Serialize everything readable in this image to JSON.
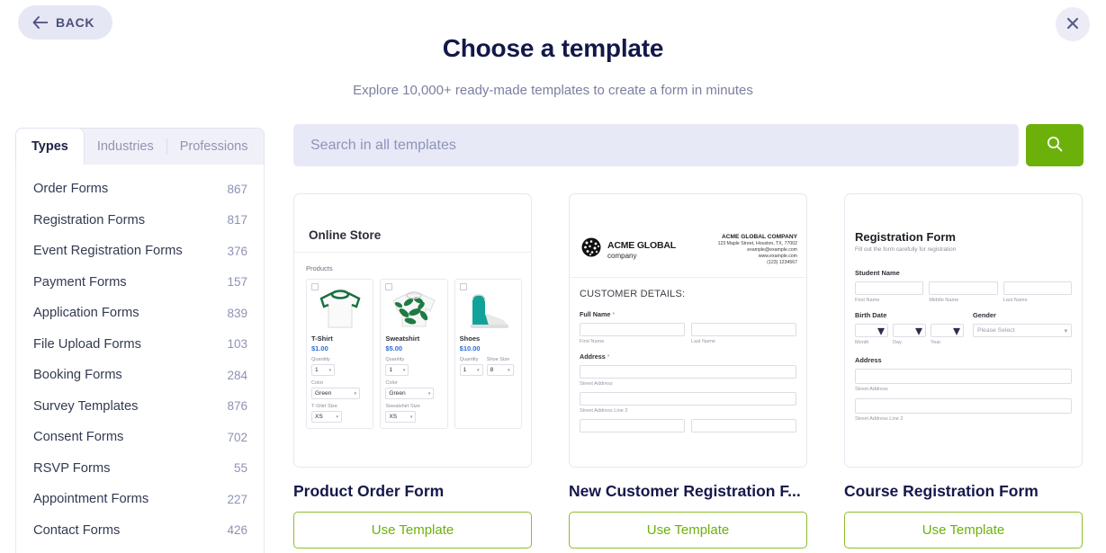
{
  "nav": {
    "back_label": "BACK",
    "close_label": "×"
  },
  "header": {
    "title": "Choose a template",
    "subtitle": "Explore 10,000+ ready-made templates to create a form in minutes"
  },
  "search": {
    "placeholder": "Search in all templates",
    "value": "",
    "button_icon": "search-icon"
  },
  "tabs": [
    {
      "label": "Types",
      "active": true
    },
    {
      "label": "Industries",
      "active": false
    },
    {
      "label": "Professions",
      "active": false
    }
  ],
  "sidebar": {
    "items": [
      {
        "label": "Order Forms",
        "count": "867"
      },
      {
        "label": "Registration Forms",
        "count": "817"
      },
      {
        "label": "Event Registration Forms",
        "count": "376"
      },
      {
        "label": "Payment Forms",
        "count": "157"
      },
      {
        "label": "Application Forms",
        "count": "839"
      },
      {
        "label": "File Upload Forms",
        "count": "103"
      },
      {
        "label": "Booking Forms",
        "count": "284"
      },
      {
        "label": "Survey Templates",
        "count": "876"
      },
      {
        "label": "Consent Forms",
        "count": "702"
      },
      {
        "label": "RSVP Forms",
        "count": "55"
      },
      {
        "label": "Appointment Forms",
        "count": "227"
      },
      {
        "label": "Contact Forms",
        "count": "426"
      }
    ]
  },
  "cards": [
    {
      "title": "Product Order Form",
      "button_label": "Use Template",
      "preview": {
        "heading": "Online Store",
        "section_label": "Products",
        "products": [
          {
            "name": "T-Shirt",
            "price": "$1.00",
            "qty_label": "Quantity",
            "qty_value": "1",
            "color_label": "Color",
            "color_value": "Green",
            "size_label": "T-Shirt Size",
            "size_value": "XS"
          },
          {
            "name": "Sweatshirt",
            "price": "$5.00",
            "qty_label": "Quantity",
            "qty_value": "1",
            "color_label": "Color",
            "color_value": "Green",
            "size_label": "Sweatshirt Size",
            "size_value": "XS"
          },
          {
            "name": "Shoes",
            "price": "$10.00",
            "qty_label": "Quantity",
            "qty_value": "1",
            "size_label": "Shoe Size",
            "size_value": "8"
          }
        ]
      }
    },
    {
      "title": "New Customer Registration F...",
      "button_label": "Use Template",
      "preview": {
        "logo_name": "ACME GLOBAL",
        "logo_sub": "company",
        "company_name": "ACME GLOBAL COMPANY",
        "company_address": "123 Maple Street, Houston, TX, 77002",
        "company_email": "example@example.com",
        "company_site": "www.example.com",
        "company_phone": "(123) 1234567",
        "section_heading": "CUSTOMER DETAILS:",
        "full_name_label": "Full Name",
        "required_mark": "*",
        "first_name_hint": "First Name",
        "last_name_hint": "Last Name",
        "address_label": "Address",
        "street_hint": "Street Address",
        "street2_hint": "Street Address Line 2"
      }
    },
    {
      "title": "Course Registration Form",
      "button_label": "Use Template",
      "preview": {
        "heading": "Registration Form",
        "subheading": "Fill out the form carefully for registration",
        "student_name_label": "Student Name",
        "first_name_hint": "First Name",
        "middle_name_hint": "Middle Name",
        "last_name_hint": "Last Name",
        "birth_date_label": "Birth Date",
        "month_hint": "Month",
        "day_hint": "Day",
        "year_hint": "Year",
        "gender_label": "Gender",
        "gender_value": "Please Select",
        "address_label": "Address",
        "street_hint": "Street Address",
        "street2_hint": "Street Address Line 2"
      }
    }
  ],
  "colors": {
    "accent_green": "#6cb10a",
    "title_navy": "#13184a",
    "search_bg": "#e8e9f6"
  }
}
